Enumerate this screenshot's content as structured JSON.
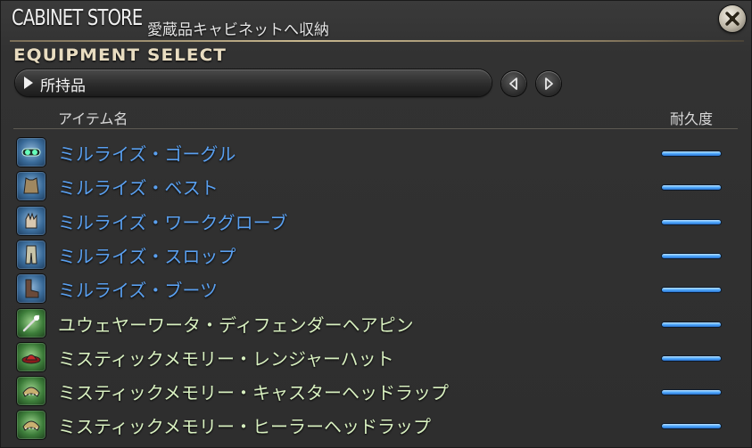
{
  "window": {
    "title": "CABINET STORE",
    "subtitle": "愛蔵品キャビネットへ収納"
  },
  "section": {
    "title": "EQUIPMENT SELECT"
  },
  "filter": {
    "selected": "所持品"
  },
  "columns": {
    "name": "アイテム名",
    "durability": "耐久度"
  },
  "colors": {
    "rare_blue": "#5aa0f0",
    "normal_green": "#d8f0c0",
    "bar_blue": "#4ea9ff",
    "accent_gold": "#c9b88f"
  },
  "items": [
    {
      "name": "ミルライズ・ゴーグル",
      "rarity": "blue",
      "icon": "goggles-icon",
      "durability": 1.0
    },
    {
      "name": "ミルライズ・ベスト",
      "rarity": "blue",
      "icon": "vest-icon",
      "durability": 1.0
    },
    {
      "name": "ミルライズ・ワークグローブ",
      "rarity": "blue",
      "icon": "gloves-icon",
      "durability": 1.0
    },
    {
      "name": "ミルライズ・スロップ",
      "rarity": "blue",
      "icon": "trousers-icon",
      "durability": 1.0
    },
    {
      "name": "ミルライズ・ブーツ",
      "rarity": "blue",
      "icon": "boots-icon",
      "durability": 1.0
    },
    {
      "name": "ユウェヤーワータ・ディフェンダーヘアピン",
      "rarity": "green",
      "icon": "hairpin-icon",
      "durability": 1.0
    },
    {
      "name": "ミスティックメモリー・レンジャーハット",
      "rarity": "green",
      "icon": "hat-icon",
      "durability": 1.0
    },
    {
      "name": "ミスティックメモリー・キャスターヘッドラップ",
      "rarity": "green",
      "icon": "headwrap-icon",
      "durability": 1.0
    },
    {
      "name": "ミスティックメモリー・ヒーラーヘッドラップ",
      "rarity": "green",
      "icon": "headwrap-icon",
      "durability": 1.0
    }
  ]
}
